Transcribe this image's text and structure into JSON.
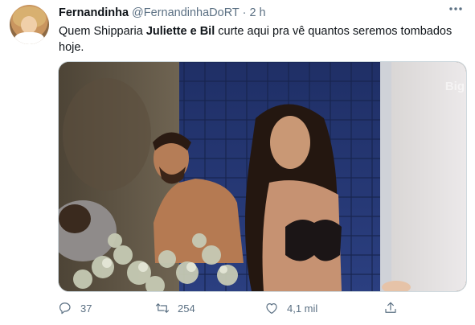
{
  "tweet": {
    "author": {
      "display_name": "Fernandinha",
      "handle": "@FernandinhaDoRT",
      "separator": "·",
      "time": "2 h"
    },
    "text": {
      "part1": "Quem Shipparia ",
      "bold": "Juliette e Bil",
      "part2": " curte aqui pra vê quantos seremos tombados hoje."
    },
    "media": {
      "watermark": "Big"
    },
    "actions": {
      "replies": "37",
      "retweets": "254",
      "likes": "4,1 mil"
    },
    "icons": {
      "more": "more-dots-icon",
      "reply": "reply-icon",
      "retweet": "retweet-icon",
      "like": "heart-icon",
      "share": "share-icon"
    },
    "colors": {
      "text": "#0f1419",
      "secondary": "#5b7083",
      "border": "#cfd9de"
    }
  }
}
